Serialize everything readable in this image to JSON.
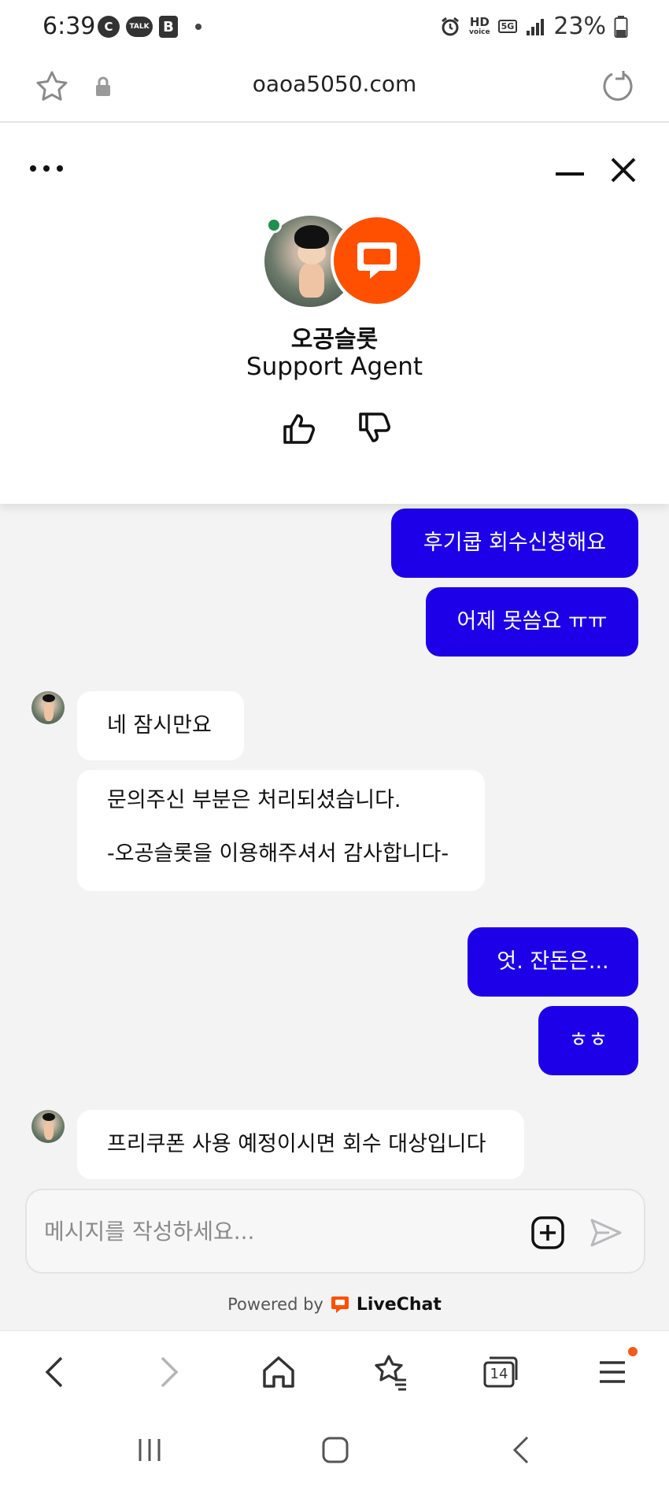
{
  "status_bar": {
    "time": "6:39",
    "left_badges": [
      "C",
      "TALK",
      "B"
    ],
    "hd": "HD",
    "voice": "voice",
    "network": "5G",
    "battery_pct": "23%"
  },
  "browser": {
    "url": "oaoa5050.com"
  },
  "chat": {
    "agent_name": "오공슬롯",
    "agent_role": "Support Agent",
    "messages": [
      {
        "from": "visitor",
        "text": "후기쿱 회수신청해요"
      },
      {
        "from": "visitor",
        "text": "어제 못씀요 ㅠㅠ"
      },
      {
        "from": "agent",
        "text": "네 잠시만요"
      },
      {
        "from": "agent",
        "lines": [
          "문의주신 부분은 처리되셨습니다.",
          "-오공슬롯을 이용해주셔서 감사합니다-"
        ]
      },
      {
        "from": "visitor",
        "text": "엇. 잔돈은..."
      },
      {
        "from": "visitor",
        "text": "ㅎㅎ"
      },
      {
        "from": "agent",
        "text": "프리쿠폰 사용 예정이시면 회수 대상입니다"
      }
    ],
    "composer_placeholder": "메시지를 작성하세요...",
    "powered_by": "Powered by",
    "brand": "LiveChat"
  },
  "browser_nav": {
    "tabs_count": "14"
  },
  "colors": {
    "outgoing_bubble": "#1e00e8",
    "livechat_orange": "#fe5000",
    "online_dot": "#1e8f50",
    "chat_background": "#f3f3f4"
  },
  "icons": [
    "star-icon",
    "lock-icon",
    "reload-icon",
    "more-icon",
    "minimize-icon",
    "close-icon",
    "livechat-icon",
    "thumbs-up-icon",
    "thumbs-down-icon",
    "attach-icon",
    "send-icon",
    "back-icon",
    "forward-icon",
    "home-icon",
    "bookmarks-icon",
    "tabs-icon",
    "menu-icon"
  ]
}
